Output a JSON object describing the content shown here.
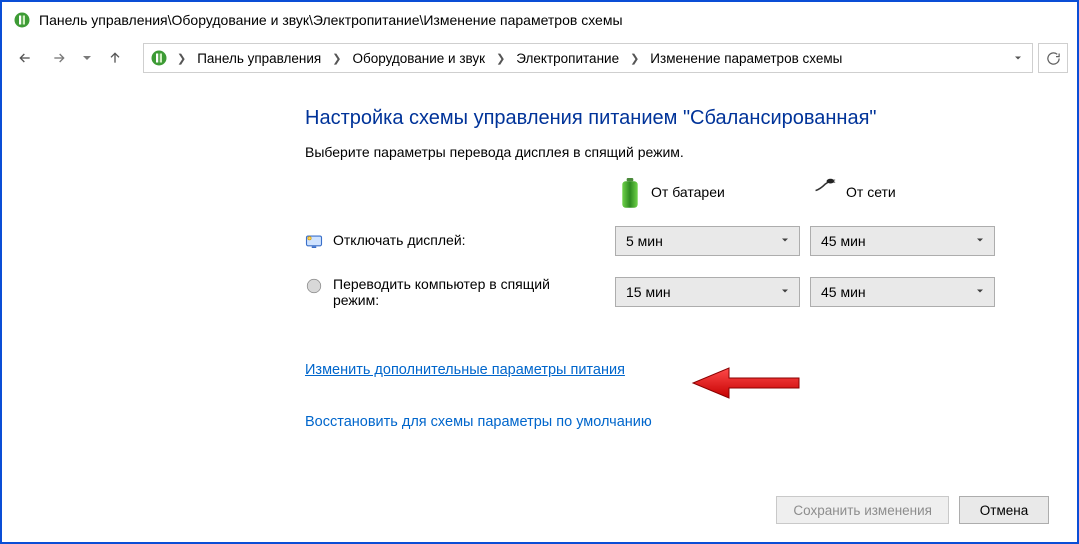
{
  "window": {
    "title": "Панель управления\\Оборудование и звук\\Электропитание\\Изменение параметров схемы"
  },
  "breadcrumb": {
    "items": [
      "Панель управления",
      "Оборудование и звук",
      "Электропитание",
      "Изменение параметров схемы"
    ]
  },
  "main": {
    "heading": "Настройка схемы управления питанием \"Сбалансированная\"",
    "subtext": "Выберите параметры перевода дисплея в спящий режим.",
    "col_battery": "От батареи",
    "col_plugged": "От сети",
    "rows": [
      {
        "label": "Отключать дисплей:",
        "battery": "5 мин",
        "plugged": "45 мин"
      },
      {
        "label": "Переводить компьютер в спящий режим:",
        "battery": "15 мин",
        "plugged": "45 мин"
      }
    ],
    "link_advanced": "Изменить дополнительные параметры питания",
    "link_restore": "Восстановить для схемы параметры по умолчанию"
  },
  "footer": {
    "save": "Сохранить изменения",
    "cancel": "Отмена"
  }
}
